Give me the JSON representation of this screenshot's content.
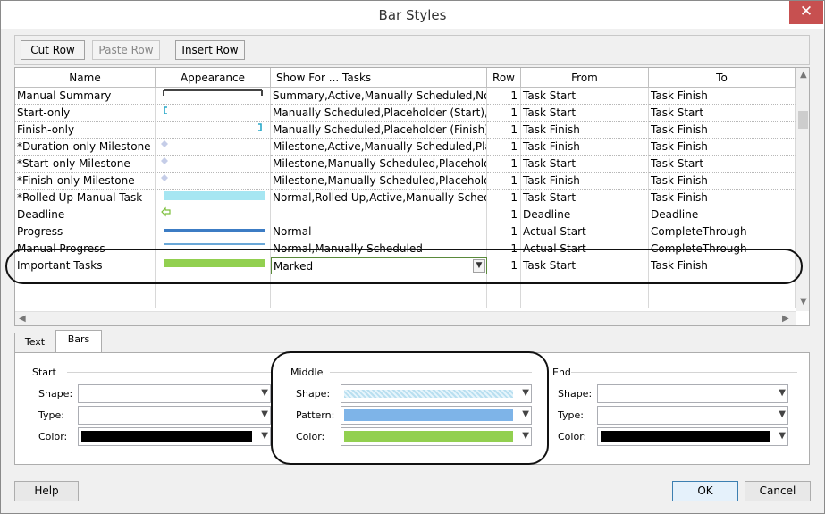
{
  "window": {
    "title": "Bar Styles",
    "close_glyph": "✕"
  },
  "toolbar": {
    "cut_row": "Cut Row",
    "paste_row": "Paste Row",
    "insert_row": "Insert Row"
  },
  "grid": {
    "columns": {
      "name": "Name",
      "appearance": "Appearance",
      "show_for": "Show For ... Tasks",
      "row": "Row",
      "from": "From",
      "to": "To"
    },
    "rows": [
      {
        "name": "Manual Summary",
        "show_for": "Summary,Active,Manually Scheduled,Not",
        "row": "1",
        "from": "Task Start",
        "to": "Task Finish",
        "appearance": "bracket"
      },
      {
        "name": "Start-only",
        "show_for": "Manually Scheduled,Placeholder (Start),N",
        "row": "1",
        "from": "Task Start",
        "to": "Task Start",
        "appearance": "start-bracket"
      },
      {
        "name": "Finish-only",
        "show_for": "Manually Scheduled,Placeholder (Finish),I",
        "row": "1",
        "from": "Task Finish",
        "to": "Task Finish",
        "appearance": "finish-bracket"
      },
      {
        "name": "*Duration-only Milestone",
        "show_for": "Milestone,Active,Manually Scheduled,Plac",
        "row": "1",
        "from": "Task Finish",
        "to": "Task Finish",
        "appearance": "diamond"
      },
      {
        "name": "*Start-only Milestone",
        "show_for": "Milestone,Manually Scheduled,Placehold",
        "row": "1",
        "from": "Task Start",
        "to": "Task Start",
        "appearance": "diamond"
      },
      {
        "name": "*Finish-only Milestone",
        "show_for": "Milestone,Manually Scheduled,Placehold",
        "row": "1",
        "from": "Task Finish",
        "to": "Task Finish",
        "appearance": "diamond"
      },
      {
        "name": "*Rolled Up Manual Task",
        "show_for": "Normal,Rolled Up,Active,Manually Sched",
        "row": "1",
        "from": "Task Start",
        "to": "Task Finish",
        "appearance": "light-bar"
      },
      {
        "name": "Deadline",
        "show_for": "",
        "row": "1",
        "from": "Deadline",
        "to": "Deadline",
        "appearance": "arrow"
      },
      {
        "name": "Progress",
        "show_for": "Normal",
        "row": "1",
        "from": "Actual Start",
        "to": "CompleteThrough",
        "appearance": "progress-line"
      },
      {
        "name": "Manual Progress",
        "show_for": "Normal,Manually Scheduled",
        "row": "1",
        "from": "Actual Start",
        "to": "CompleteThrough",
        "appearance": "progress-line2"
      },
      {
        "name": "Important Tasks",
        "show_for": "Marked",
        "row": "1",
        "from": "Task Start",
        "to": "Task Finish",
        "appearance": "green-bar"
      }
    ]
  },
  "tabs": {
    "text": "Text",
    "bars": "Bars"
  },
  "bars": {
    "start": {
      "title": "Start",
      "shape_label": "Shape:",
      "type_label": "Type:",
      "color_label": "Color:",
      "color_hex": "#000000"
    },
    "middle": {
      "title": "Middle",
      "shape_label": "Shape:",
      "pattern_label": "Pattern:",
      "color_label": "Color:",
      "shape_hex": "#b8dff0",
      "pattern_hex": "#7eb4e8",
      "color_hex": "#92d050"
    },
    "end": {
      "title": "End",
      "shape_label": "Shape:",
      "type_label": "Type:",
      "color_label": "Color:",
      "color_hex": "#000000"
    }
  },
  "buttons": {
    "help": "Help",
    "ok": "OK",
    "cancel": "Cancel"
  },
  "colors": {
    "accent_green": "#92d050",
    "progress_blue": "#3c7cc4",
    "rollup_cyan": "#a6e6f2",
    "close_red": "#c75050"
  }
}
